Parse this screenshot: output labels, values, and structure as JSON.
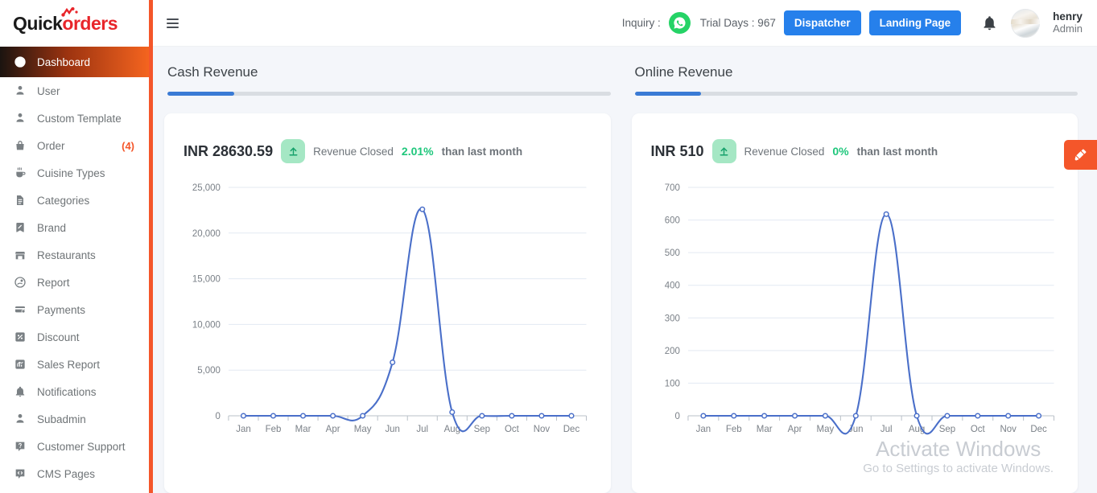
{
  "brand": {
    "name_part1": "Quick",
    "name_part2": "orders"
  },
  "sidebar": {
    "items": [
      {
        "label": "Dashboard",
        "icon": "dashboard-icon",
        "active": true
      },
      {
        "label": "User",
        "icon": "user-icon"
      },
      {
        "label": "Custom Template",
        "icon": "user-icon"
      },
      {
        "label": "Order",
        "icon": "bag-icon",
        "count": "(4)"
      },
      {
        "label": "Cuisine Types",
        "icon": "cup-icon"
      },
      {
        "label": "Categories",
        "icon": "file-icon"
      },
      {
        "label": "Brand",
        "icon": "tag-icon"
      },
      {
        "label": "Restaurants",
        "icon": "store-icon"
      },
      {
        "label": "Report",
        "icon": "report-icon"
      },
      {
        "label": "Payments",
        "icon": "card-icon"
      },
      {
        "label": "Discount",
        "icon": "percent-icon"
      },
      {
        "label": "Sales Report",
        "icon": "chart-icon"
      },
      {
        "label": "Notifications",
        "icon": "bell-icon"
      },
      {
        "label": "Subadmin",
        "icon": "user-icon"
      },
      {
        "label": "Customer Support",
        "icon": "help-icon"
      },
      {
        "label": "CMS Pages",
        "icon": "code-icon"
      }
    ]
  },
  "topbar": {
    "menu_icon": "hamburger-icon",
    "inquiry_label": "Inquiry :",
    "whatsapp_icon": "whatsapp-icon",
    "trial_days": "Trial Days : 967",
    "dispatcher_button": "Dispatcher",
    "landing_page_button": "Landing Page",
    "notification_icon": "bell-icon",
    "user_name": "henry",
    "user_role": "Admin"
  },
  "theme_button": {
    "icon": "paintbrush-icon",
    "color": "#f4562a"
  },
  "watermark": {
    "line1": "Activate Windows",
    "line2": "Go to Settings to activate Windows."
  },
  "cards": [
    {
      "title": "Cash Revenue",
      "progress_percent": 15,
      "amount": "INR 28630.59",
      "trend_icon": "arrow-up-icon",
      "status_text": "Revenue Closed",
      "percent": "2.01%",
      "percent_tail": "than last month"
    },
    {
      "title": "Online Revenue",
      "progress_percent": 15,
      "amount": "INR 510",
      "trend_icon": "arrow-up-icon",
      "status_text": "Revenue Closed",
      "percent": "0%",
      "percent_tail": "than last month"
    }
  ],
  "chart_data": [
    {
      "type": "line",
      "title": "Cash Revenue",
      "categories": [
        "Jan",
        "Feb",
        "Mar",
        "Apr",
        "May",
        "Jun",
        "Jul",
        "Aug",
        "Sep",
        "Oct",
        "Nov",
        "Dec"
      ],
      "values": [
        0,
        0,
        0,
        0,
        0,
        5850,
        22600,
        400,
        0,
        0,
        0,
        0
      ],
      "xlabel": "",
      "ylabel": "",
      "ylim": [
        0,
        25000
      ],
      "yticks": [
        0,
        5000,
        10000,
        15000,
        20000,
        25000
      ],
      "ytick_labels": [
        "0",
        "5,000",
        "10,000",
        "15,000",
        "20,000",
        "25,000"
      ],
      "grid": true,
      "legend": false,
      "series_color": "#4a6fc9",
      "curve": "spline"
    },
    {
      "type": "line",
      "title": "Online Revenue",
      "categories": [
        "Jan",
        "Feb",
        "Mar",
        "Apr",
        "May",
        "Jun",
        "Jul",
        "Aug",
        "Sep",
        "Oct",
        "Nov",
        "Dec"
      ],
      "values": [
        0,
        0,
        0,
        0,
        0,
        0,
        618,
        0,
        0,
        0,
        0,
        0
      ],
      "xlabel": "",
      "ylabel": "",
      "ylim": [
        0,
        700
      ],
      "yticks": [
        0,
        100,
        200,
        300,
        400,
        500,
        600,
        700
      ],
      "ytick_labels": [
        "0",
        "100",
        "200",
        "300",
        "400",
        "500",
        "600",
        "700"
      ],
      "grid": true,
      "legend": false,
      "series_color": "#4a6fc9",
      "curve": "spline"
    }
  ]
}
